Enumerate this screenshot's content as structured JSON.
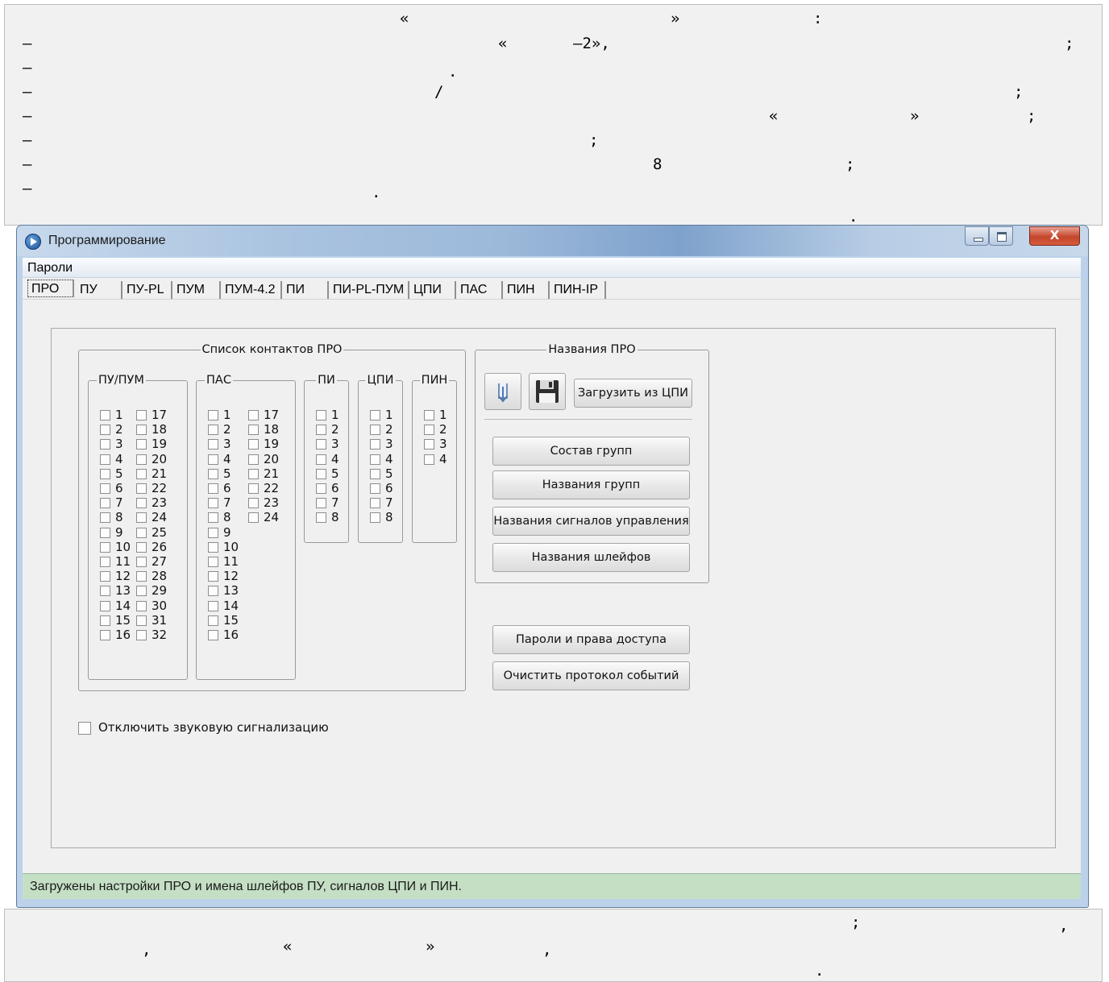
{
  "document_top": {
    "lines": [
      "«",
      "»",
      ":",
      "–",
      "«",
      "–2»,",
      ";",
      "–",
      ".",
      "–",
      "/",
      ";",
      "–",
      "«",
      "»",
      ";",
      "–",
      ";",
      "–",
      "8",
      ";",
      "–",
      ".",
      "."
    ]
  },
  "window": {
    "title": "Программирование",
    "close_glyph": "X",
    "menu": {
      "passwords": "Пароли"
    },
    "tabs": [
      "ПРО",
      "ПУ",
      "ПУ-PL",
      "ПУМ",
      "ПУМ-4.2",
      "ПИ",
      "ПИ-PL-ПУМ",
      "ЦПИ",
      "ПАС",
      "ПИН",
      "ПИН-IP"
    ],
    "active_tab": "ПРО",
    "contacts": {
      "legend": "Список контактов ПРО",
      "groups": {
        "pu_pum": {
          "legend": "ПУ/ПУМ",
          "col1": [
            "1",
            "2",
            "3",
            "4",
            "5",
            "6",
            "7",
            "8",
            "9",
            "10",
            "11",
            "12",
            "13",
            "14",
            "15",
            "16"
          ],
          "col2": [
            "17",
            "18",
            "19",
            "20",
            "21",
            "22",
            "23",
            "24",
            "25",
            "26",
            "27",
            "28",
            "29",
            "30",
            "31",
            "32"
          ]
        },
        "pas": {
          "legend": "ПАС",
          "col1": [
            "1",
            "2",
            "3",
            "4",
            "5",
            "6",
            "7",
            "8",
            "9",
            "10",
            "11",
            "12",
            "13",
            "14",
            "15",
            "16"
          ],
          "col2": [
            "17",
            "18",
            "19",
            "20",
            "21",
            "22",
            "23",
            "24"
          ]
        },
        "pi": {
          "legend": "ПИ",
          "col1": [
            "1",
            "2",
            "3",
            "4",
            "5",
            "6",
            "7",
            "8"
          ]
        },
        "cpi": {
          "legend": "ЦПИ",
          "col1": [
            "1",
            "2",
            "3",
            "4",
            "5",
            "6",
            "7",
            "8"
          ]
        },
        "pin": {
          "legend": "ПИН",
          "col1": [
            "1",
            "2",
            "3",
            "4"
          ]
        }
      }
    },
    "names": {
      "legend": "Названия ПРО",
      "load_from_cpi": "Загрузить из ЦПИ",
      "group_composition": "Состав групп",
      "group_names": "Названия групп",
      "control_signal_names": "Названия сигналов управления",
      "loop_names": "Названия шлейфов"
    },
    "passwords_rights": "Пароли и права доступа",
    "clear_log": "Очистить протокол событий",
    "disable_sound": "Отключить звуковую сигнализацию",
    "status": "Загружены настройки ПРО и имена шлейфов ПУ, сигналов ЦПИ и ПИН."
  },
  "document_bottom": {
    "lines": [
      ";",
      ",",
      ",",
      "«",
      "»",
      ",",
      "."
    ]
  },
  "colors": {
    "status_bg": "#c5dfc5",
    "title_bar": "#a9c3e0",
    "close_button": "#c4462c"
  }
}
